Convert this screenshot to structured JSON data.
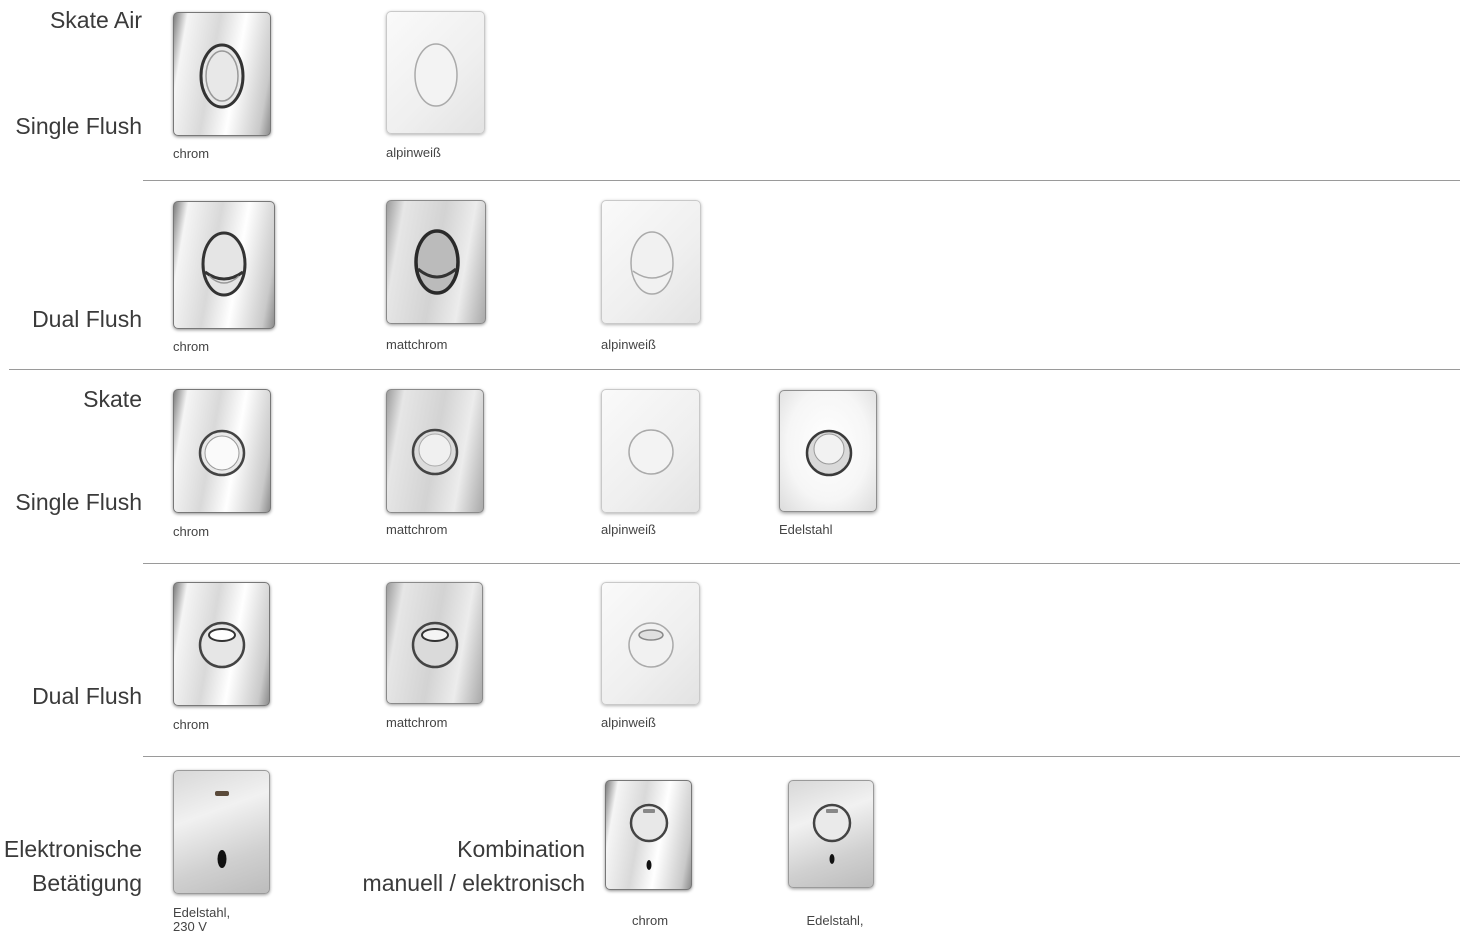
{
  "section_skate_air": {
    "title": "Skate Air",
    "single_label": "Single Flush",
    "single_captions": [
      "chrom",
      "alpinweiß"
    ],
    "dual_label": "Dual Flush",
    "dual_captions": [
      "chrom",
      "mattchrom",
      "alpinweiß"
    ]
  },
  "section_skate": {
    "title": "Skate",
    "single_label": "Single Flush",
    "single_captions": [
      "chrom",
      "mattchrom",
      "alpinweiß",
      "Edelstahl"
    ],
    "dual_label": "Dual Flush",
    "dual_captions": [
      "chrom",
      "mattchrom",
      "alpinweiß"
    ]
  },
  "section_electronic": {
    "label_line1": "Elektronische",
    "label_line2": "Betätigung",
    "caption_line1": "Edelstahl,",
    "caption_line2": "230 V",
    "combo_label_line1": "Kombination",
    "combo_label_line2": "manuell / elektronisch",
    "combo_captions": [
      "chrom",
      "Edelstahl,"
    ]
  },
  "colors": {
    "rule": "#9a9a9a",
    "text": "#3a3a3a"
  }
}
